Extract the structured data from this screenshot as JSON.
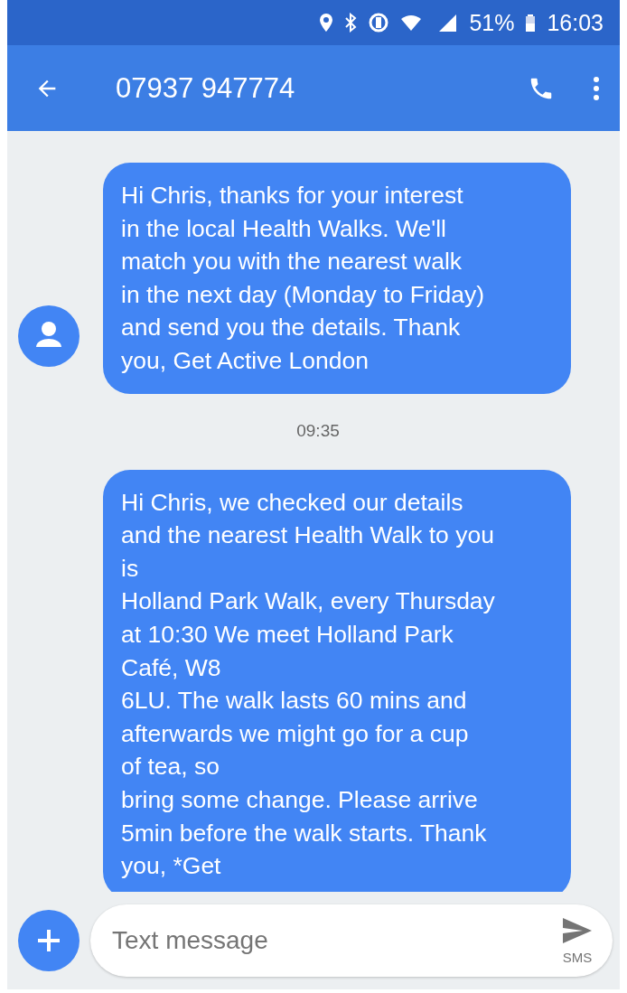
{
  "status_bar": {
    "battery": "51%",
    "time": "16:03"
  },
  "app_bar": {
    "title": "07937 947774"
  },
  "conversation": [
    {
      "kind": "message",
      "text": "Hi Chris, thanks for your interest\nin the local Health Walks. We'll\nmatch you with the nearest walk\nin the next day (Monday to Friday)\nand send you the details. Thank\nyou, Get Active London"
    },
    {
      "kind": "timestamp",
      "text": "09:35"
    },
    {
      "kind": "message",
      "text": "Hi Chris, we checked our details\nand the nearest Health Walk to you\nis\nHolland Park Walk, every Thursday\nat 10:30 We meet Holland Park\nCafé, W8\n6LU. The walk lasts 60 mins and\nafterwards we might go for a cup\nof tea, so\nbring some change. Please arrive\n5min before the walk starts. Thank\nyou, *Get"
    }
  ],
  "composer": {
    "placeholder": "Text message",
    "send_label": "SMS"
  }
}
